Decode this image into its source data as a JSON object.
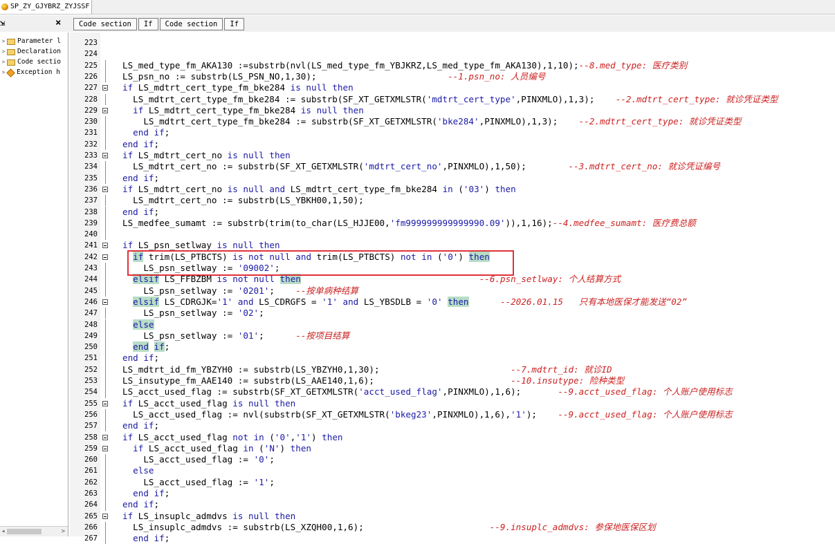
{
  "tab": {
    "title": "SP_ZY_GJYBRZ_ZYJSSF"
  },
  "toolbar": {
    "buttons": [
      "Code section",
      "If",
      "Code section",
      "If"
    ],
    "close_label": "×"
  },
  "tree": {
    "items": [
      {
        "label": "Parameter l",
        "icon": "folder-icon"
      },
      {
        "label": "Declaration",
        "icon": "folder-icon"
      },
      {
        "label": "Code sectio",
        "icon": "folder-icon"
      },
      {
        "label": "Exception h",
        "icon": "exception-icon"
      }
    ]
  },
  "code": {
    "lines": [
      {
        "n": "223",
        "fold": false,
        "text": ""
      },
      {
        "n": "224",
        "fold": false,
        "text": ""
      },
      {
        "n": "225",
        "fold": false,
        "text": "LS_med_type_fm_AKA130 :=substrb(nvl(LS_med_type_fm_YBJKRZ,LS_med_type_fm_AKA130),1,10);",
        "comment": "--8.med_type: 医疗类别",
        "cpad": 0
      },
      {
        "n": "226",
        "fold": false,
        "text": "LS_psn_no := substrb(LS_PSN_NO,1,30);",
        "comment": "--1.psn_no: 人员编号",
        "cpad": 25
      },
      {
        "n": "227",
        "fold": true,
        "text": "if LS_mdtrt_cert_type_fm_bke284 is null then"
      },
      {
        "n": "228",
        "fold": false,
        "text": "  LS_mdtrt_cert_type_fm_bke284 := substrb(SF_XT_GETXMLSTR('mdtrt_cert_type',PINXMLO),1,3);",
        "comment": "--2.mdtrt_cert_type: 就诊凭证类型",
        "cpad": 4
      },
      {
        "n": "229",
        "fold": true,
        "text": "  if LS_mdtrt_cert_type_fm_bke284 is null then"
      },
      {
        "n": "230",
        "fold": false,
        "text": "    LS_mdtrt_cert_type_fm_bke284 := substrb(SF_XT_GETXMLSTR('bke284',PINXMLO),1,3);",
        "comment": "--2.mdtrt_cert_type: 就诊凭证类型",
        "cpad": 4
      },
      {
        "n": "231",
        "fold": false,
        "text": "  end if;"
      },
      {
        "n": "232",
        "fold": false,
        "text": "end if;"
      },
      {
        "n": "233",
        "fold": true,
        "text": "if LS_mdtrt_cert_no is null then"
      },
      {
        "n": "234",
        "fold": false,
        "text": "  LS_mdtrt_cert_no := substrb(SF_XT_GETXMLSTR('mdtrt_cert_no',PINXMLO),1,50);",
        "comment": "--3.mdtrt_cert_no: 就诊凭证编号",
        "cpad": 8
      },
      {
        "n": "235",
        "fold": false,
        "text": "end if;"
      },
      {
        "n": "236",
        "fold": true,
        "text": "if LS_mdtrt_cert_no is null and LS_mdtrt_cert_type_fm_bke284 in ('03') then"
      },
      {
        "n": "237",
        "fold": false,
        "text": "  LS_mdtrt_cert_no := substrb(LS_YBKH00,1,50);"
      },
      {
        "n": "238",
        "fold": false,
        "text": "end if;"
      },
      {
        "n": "239",
        "fold": false,
        "text": "LS_medfee_sumamt := substrb(trim(to_char(LS_HJJE00,'fm999999999999990.09')),1,16);",
        "comment": "--4.medfee_sumamt: 医疗费总额",
        "cpad": 0
      },
      {
        "n": "240",
        "fold": false,
        "text": ""
      },
      {
        "n": "241",
        "fold": true,
        "text": "if LS_psn_setlway is null then"
      },
      {
        "n": "242",
        "fold": true,
        "text": "  if trim(LS_PTBCTS) is not null and trim(LS_PTBCTS) not in ('0') then"
      },
      {
        "n": "243",
        "fold": false,
        "text": "    LS_psn_setlway := '09002';"
      },
      {
        "n": "244",
        "fold": false,
        "text": "  elsif LS_FFBZBM is not null then",
        "comment": "--6.psn_setlway: 个人结算方式",
        "cpad": 34
      },
      {
        "n": "245",
        "fold": false,
        "text": "    LS_psn_setlway := '0201';",
        "comment": "--按单病种结算",
        "cpad": 4
      },
      {
        "n": "246",
        "fold": true,
        "text": "  elsif LS_CDRGJK='1' and LS_CDRGFS = '1' and LS_YBSDLB = '0' then",
        "comment": "--2026.01.15   只有本地医保才能发送“02”",
        "cpad": 6
      },
      {
        "n": "247",
        "fold": false,
        "text": "    LS_psn_setlway := '02';"
      },
      {
        "n": "248",
        "fold": false,
        "text": "  else"
      },
      {
        "n": "249",
        "fold": false,
        "text": "    LS_psn_setlway := '01';",
        "comment": "--按项目结算",
        "cpad": 6
      },
      {
        "n": "250",
        "fold": false,
        "text": "  end if;"
      },
      {
        "n": "251",
        "fold": false,
        "text": "end if;"
      },
      {
        "n": "252",
        "fold": false,
        "text": "LS_mdtrt_id_fm_YBZYH0 := substrb(LS_YBZYH0,1,30);",
        "comment": "--7.mdtrt_id: 就诊ID",
        "cpad": 25
      },
      {
        "n": "253",
        "fold": false,
        "text": "LS_insutype_fm_AAE140 := substrb(LS_AAE140,1,6);",
        "comment": "--10.insutype: 险种类型",
        "cpad": 26
      },
      {
        "n": "254",
        "fold": false,
        "text": "LS_acct_used_flag := substrb(SF_XT_GETXMLSTR('acct_used_flag',PINXMLO),1,6);",
        "comment": "--9.acct_used_flag: 个人账户使用标志",
        "cpad": 7
      },
      {
        "n": "255",
        "fold": true,
        "text": "if LS_acct_used_flag is null then"
      },
      {
        "n": "256",
        "fold": false,
        "text": "  LS_acct_used_flag := nvl(substrb(SF_XT_GETXMLSTR('bkeg23',PINXMLO),1,6),'1');",
        "comment": "--9.acct_used_flag: 个人账户使用标志",
        "cpad": 4
      },
      {
        "n": "257",
        "fold": false,
        "text": "end if;"
      },
      {
        "n": "258",
        "fold": true,
        "text": "if LS_acct_used_flag not in ('0','1') then"
      },
      {
        "n": "259",
        "fold": true,
        "text": "  if LS_acct_used_flag in ('N') then"
      },
      {
        "n": "260",
        "fold": false,
        "text": "    LS_acct_used_flag := '0';"
      },
      {
        "n": "261",
        "fold": false,
        "text": "  else"
      },
      {
        "n": "262",
        "fold": false,
        "text": "    LS_acct_used_flag := '1';"
      },
      {
        "n": "263",
        "fold": false,
        "text": "  end if;"
      },
      {
        "n": "264",
        "fold": false,
        "text": "end if;"
      },
      {
        "n": "265",
        "fold": true,
        "text": "if LS_insuplc_admdvs is null then"
      },
      {
        "n": "266",
        "fold": false,
        "text": "  LS_insuplc_admdvs := substrb(LS_XZQH00,1,6);",
        "comment": "--9.insuplc_admdvs: 参保地医保区划",
        "cpad": 24
      },
      {
        "n": "267",
        "fold": false,
        "text": "  end if;"
      }
    ]
  }
}
